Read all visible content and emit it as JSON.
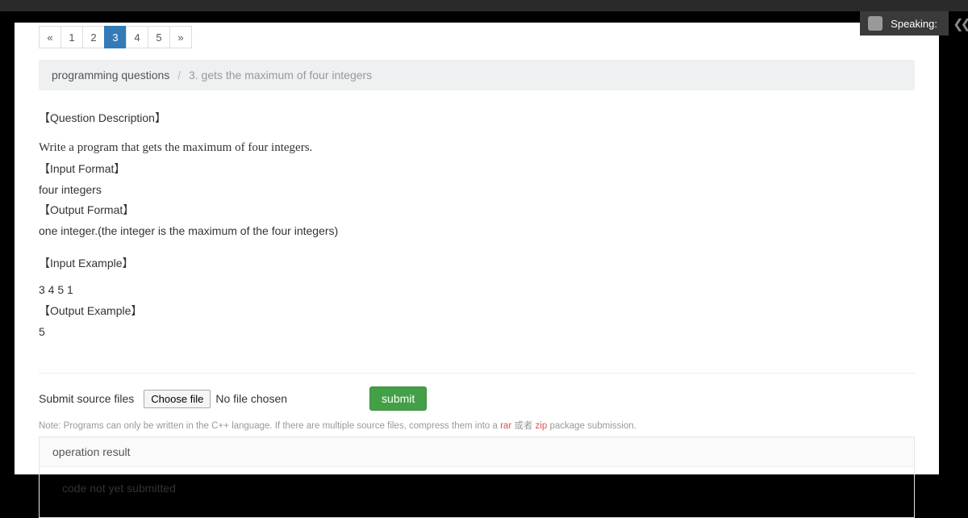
{
  "speaking": {
    "label": "Speaking:"
  },
  "pagination": {
    "prev": "«",
    "pages": [
      "1",
      "2",
      "3",
      "4",
      "5"
    ],
    "active_index": 2,
    "next": "»"
  },
  "breadcrumb": {
    "root": "programming questions",
    "sep": "/",
    "current": "3. gets the maximum of four integers"
  },
  "question": {
    "desc_header": "【Question Description】",
    "problem_statement": "Write a program that gets the maximum of four integers.",
    "input_format_header": "【Input Format】",
    "input_format_body": "four integers",
    "output_format_header": "【Output Format】",
    "output_format_body": "one integer.(the integer is the maximum of the four integers)",
    "input_example_header": "【Input Example】",
    "input_example_body": "3 4 5 1",
    "output_example_header": "【Output Example】",
    "output_example_body": "5"
  },
  "submit": {
    "label": "Submit source files",
    "choose_file": "Choose file",
    "no_file": "No file chosen",
    "button": "submit"
  },
  "note": {
    "prefix": "Note: Programs can only be written in the C++ language. If there are multiple source files, compress them into a ",
    "code1": "rar",
    "mid": " 或者 ",
    "code2": "zip",
    "suffix": " package submission."
  },
  "result": {
    "header": "operation result",
    "body": "code not yet submitted"
  }
}
